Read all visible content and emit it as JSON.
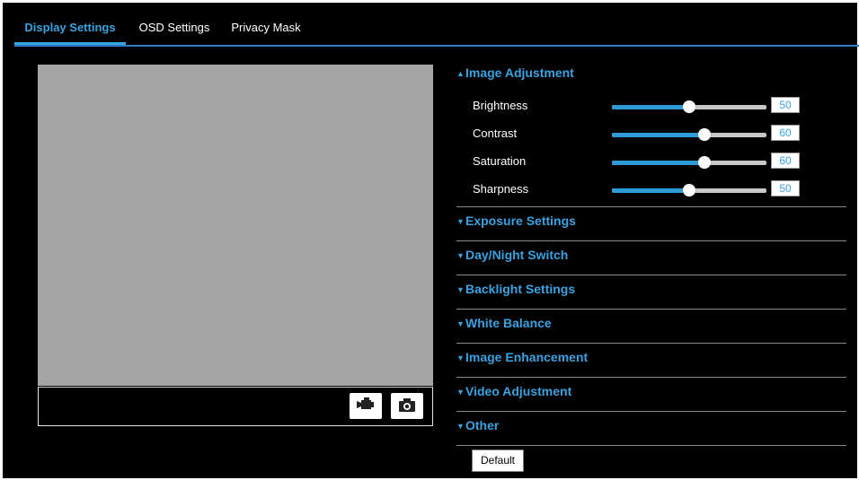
{
  "tabs": [
    {
      "label": "Display Settings",
      "active": true
    },
    {
      "label": "OSD Settings",
      "active": false
    },
    {
      "label": "Privacy Mask",
      "active": false
    }
  ],
  "preview": {
    "record_icon": "video-record-icon",
    "capture_icon": "camera-snapshot-icon"
  },
  "image_adjustment": {
    "title": "Image Adjustment",
    "expanded": true,
    "sliders": [
      {
        "label": "Brightness",
        "value": "50",
        "max": 100
      },
      {
        "label": "Contrast",
        "value": "60",
        "max": 100
      },
      {
        "label": "Saturation",
        "value": "60",
        "max": 100
      },
      {
        "label": "Sharpness",
        "value": "50",
        "max": 100
      }
    ]
  },
  "sections": [
    {
      "title": "Exposure Settings"
    },
    {
      "title": "Day/Night Switch"
    },
    {
      "title": "Backlight Settings"
    },
    {
      "title": "White Balance"
    },
    {
      "title": "Image Enhancement"
    },
    {
      "title": "Video Adjustment"
    },
    {
      "title": "Other"
    }
  ],
  "default_button": "Default",
  "colors": {
    "accent": "#3aa2e0",
    "background": "#000000",
    "preview": "#a5a5a5"
  }
}
